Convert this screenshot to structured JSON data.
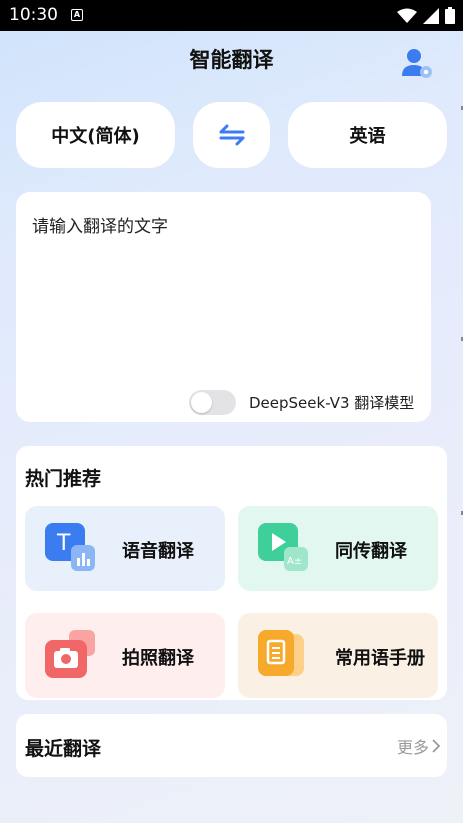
{
  "status_bar": {
    "time": "10:30",
    "notification_badge": "A"
  },
  "header": {
    "title": "智能翻译",
    "avatar_icon": "user-avatar-icon"
  },
  "languages": {
    "source": "中文(简体)",
    "swap_icon": "swap-arrows-icon",
    "target": "英语"
  },
  "input": {
    "placeholder": "请输入翻译的文字",
    "model_label": "DeepSeek-V3 翻译模型",
    "model_toggle_on": false
  },
  "recommend": {
    "title": "热门推荐",
    "items": [
      {
        "label": "语音翻译",
        "icon": "voice-translate-icon",
        "bg": "#e8f0fb"
      },
      {
        "label": "同传翻译",
        "icon": "simultaneous-translate-icon",
        "bg": "#e2f7ef"
      },
      {
        "label": "拍照翻译",
        "icon": "camera-translate-icon",
        "bg": "#feeeee"
      },
      {
        "label": "常用语手册",
        "icon": "phrasebook-icon",
        "bg": "#faf0e3"
      }
    ]
  },
  "recent": {
    "title": "最近翻译",
    "more_label": "更多"
  },
  "colors": {
    "accent": "#3b7cf0",
    "green": "#3fcf9a",
    "red": "#f16767",
    "orange": "#f6a92a"
  }
}
